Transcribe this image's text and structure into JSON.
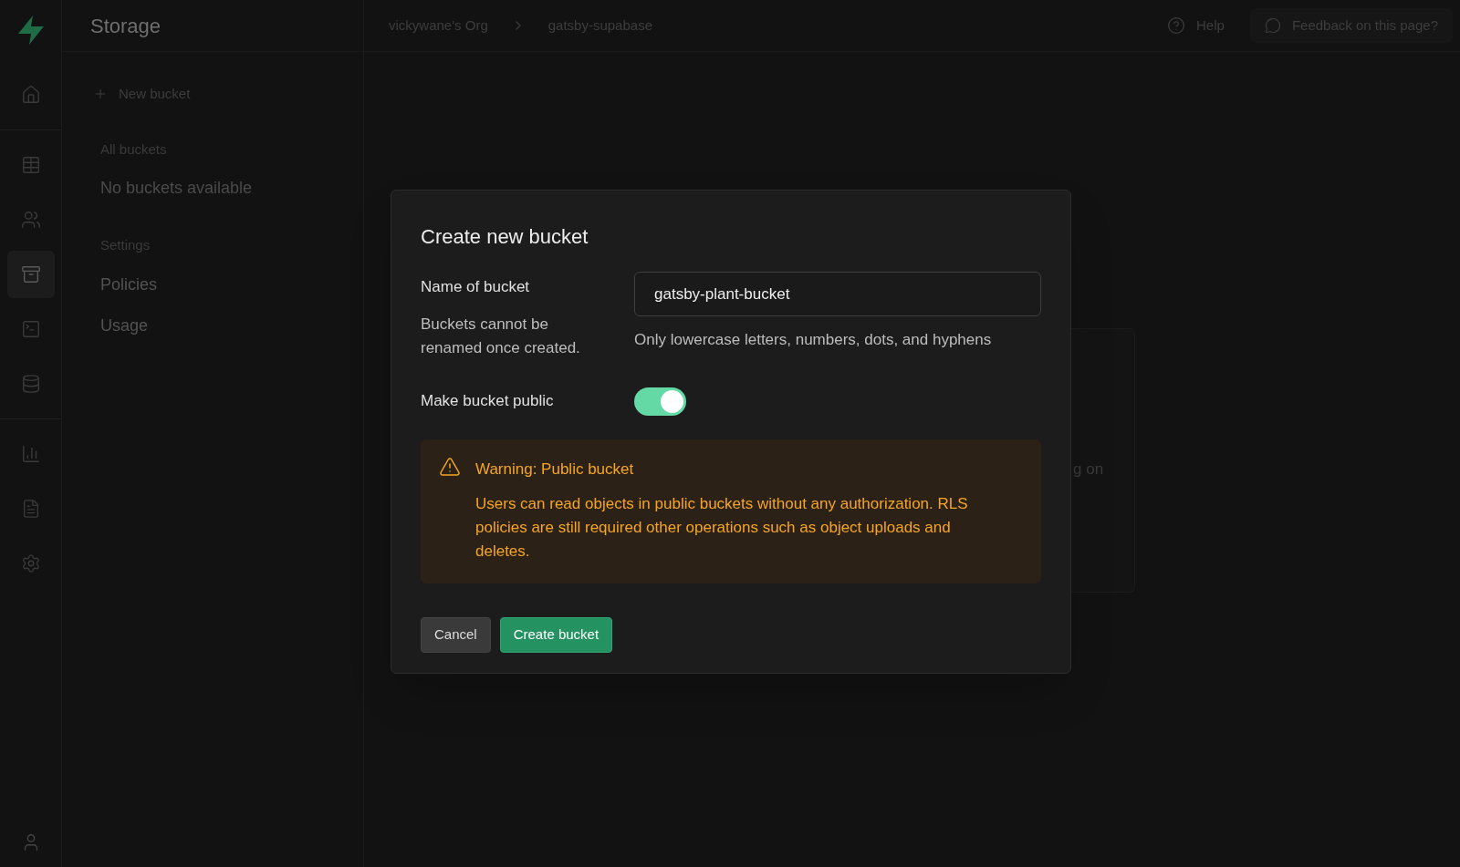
{
  "section_title": "Storage",
  "nav_rail": [
    [
      {
        "kind": "home",
        "selected": false
      }
    ],
    [
      {
        "kind": "table",
        "selected": false
      },
      {
        "kind": "users",
        "selected": false
      },
      {
        "kind": "archive",
        "selected": true
      },
      {
        "kind": "terminal",
        "selected": false
      },
      {
        "kind": "database",
        "selected": false
      }
    ],
    [
      {
        "kind": "chart",
        "selected": false
      },
      {
        "kind": "file",
        "selected": false
      },
      {
        "kind": "settings",
        "selected": false
      }
    ]
  ],
  "breadcrumb": [
    "vickywane's Org",
    "gatsby-supabase"
  ],
  "header_actions": {
    "help": "Help",
    "feedback": "Feedback on this page?"
  },
  "sidebar": {
    "new_button": "New bucket",
    "sections": [
      {
        "heading": "All buckets",
        "items": [
          {
            "label": "No buckets available",
            "kind": "empty"
          }
        ]
      },
      {
        "heading": "Settings",
        "items": [
          {
            "label": "Policies",
            "kind": "link"
          },
          {
            "label": "Usage",
            "kind": "link"
          }
        ]
      }
    ]
  },
  "background_card": {
    "text": "g on"
  },
  "dialog": {
    "title": "Create new bucket",
    "name_label": "Name of bucket",
    "name_help": "Buckets cannot be renamed once created.",
    "name_value": "gatsby-plant-bucket",
    "name_hint": "Only lowercase letters, numbers, dots, and hyphens",
    "public_label": "Make bucket public",
    "public_on": true,
    "warning": {
      "title": "Warning: Public bucket",
      "body": "Users can read objects in public buckets without any authorization. RLS policies are still required other operations such as object uploads and deletes."
    },
    "buttons": [
      {
        "label": "Cancel",
        "kind": "secondary"
      },
      {
        "label": "Create bucket",
        "kind": "primary"
      }
    ]
  }
}
